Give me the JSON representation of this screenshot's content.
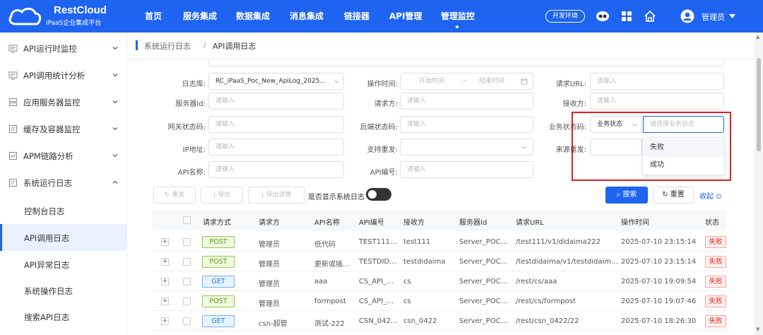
{
  "brand": {
    "name": "RestCloud",
    "sub": "iPaaS企业集成平台"
  },
  "nav": [
    "首页",
    "服务集成",
    "数据集成",
    "消息集成",
    "链接器",
    "API管理",
    "管理监控"
  ],
  "env_label": "开发环境",
  "user_name": "管理员",
  "sidebar": {
    "groups": [
      "API运行时监控",
      "API调用统计分析",
      "应用服务器监控",
      "缓存及容器监控",
      "APM链路分析",
      "系统运行日志"
    ],
    "sub_items": [
      "控制台日志",
      "API调用日志",
      "API异常日志",
      "系统操作日志",
      "搜索API日志"
    ]
  },
  "breadcrumb": {
    "parent": "系统运行日志",
    "sep": "/",
    "current": "API调用日志"
  },
  "form": {
    "log_db_label": "日志库:",
    "log_db_value": "RC_iPaaS_Poc_New_ApiLog_2025…",
    "op_time_label": "操作时间:",
    "start_ph": "开始时间",
    "range_sep": "~",
    "end_ph": "结束时间",
    "req_url_label": "请求URL:",
    "input_ph": "请输入",
    "server_id_label": "服务器Id:",
    "requester_label": "请求方:",
    "receiver_label": "接收方:",
    "gw_status_label": "网关状态码:",
    "backend_status_label": "后端状态码:",
    "biz_status_label": "业务状态码:",
    "biz_status_select": "业务状态",
    "biz_status_ph": "请选择业务状态",
    "ip_label": "IP地址:",
    "resend_label": "支持重发:",
    "source_label": "来源重发:",
    "api_name_label": "API名称:",
    "api_no_label": "API编号:"
  },
  "dropdown": [
    "失败",
    "成功"
  ],
  "toolbar": {
    "resend": "重发",
    "export": "导出",
    "export_detail": "导出详情",
    "show_sys_log": "是否显示系统日志",
    "search": "搜索",
    "reset": "重置",
    "collapse": "收起"
  },
  "table": {
    "headers": [
      "请求方式",
      "请求方",
      "API名称",
      "API编号",
      "接收方",
      "服务器Id",
      "请求URL",
      "操作时间",
      "状态"
    ],
    "rows": [
      {
        "method": "POST",
        "requester": "管理员",
        "api_name": "低代码",
        "api_no": "TEST111…",
        "receiver": "test111",
        "server": "Server_POC…",
        "url": "/test111/v1/didaima222",
        "time": "2025-07-10 23:15:14",
        "status": "失败"
      },
      {
        "method": "POST",
        "requester": "管理员",
        "api_name": "更新或插…",
        "api_no": "TESTDID…",
        "receiver": "testdidaima",
        "server": "Server_POC…",
        "url": "/testdidaima/v1/testdidaim…",
        "time": "2025-07-10 23:15:14",
        "status": "失败"
      },
      {
        "method": "GET",
        "requester": "管理员",
        "api_name": "aaa",
        "api_no": "CS_API_…",
        "receiver": "cs",
        "server": "Server_POC…",
        "url": "/rest/cs/aaa",
        "time": "2025-07-10 19:09:54",
        "status": "失败"
      },
      {
        "method": "POST",
        "requester": "管理员",
        "api_name": "formpost",
        "api_no": "CS_API_…",
        "receiver": "cs",
        "server": "Server_POC…",
        "url": "/rest/cs/formpost",
        "time": "2025-07-10 19:07:46",
        "status": "失败"
      },
      {
        "method": "GET",
        "requester": "csn-超管",
        "api_name": "测试-222",
        "api_no": "CSN_042…",
        "receiver": "csn_0422",
        "server": "Server_POC…",
        "url": "/rest/csn_0422/22",
        "time": "2025-07-10 18:26:30",
        "status": "失败"
      }
    ]
  },
  "colors": {
    "primary": "#1e64f0",
    "danger": "#e02020",
    "post": "#8fcb48",
    "get": "#69b1ff"
  }
}
